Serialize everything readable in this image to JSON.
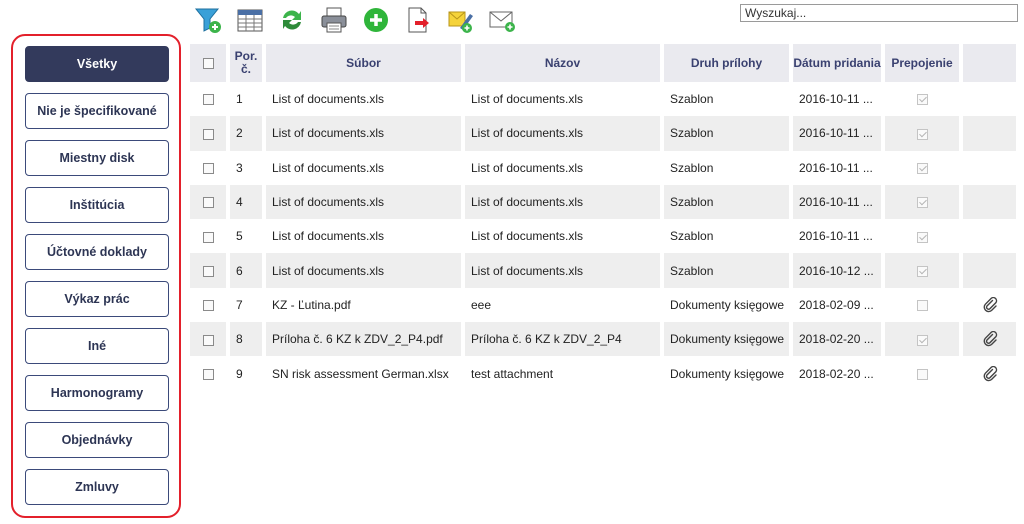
{
  "search": {
    "placeholder": "Wyszukaj..."
  },
  "toolbar": {
    "icons": [
      "filter-add-icon",
      "table-columns-icon",
      "refresh-icon",
      "print-icon",
      "add-icon",
      "export-document-icon",
      "edit-attachment-icon",
      "mail-add-icon"
    ]
  },
  "sidebar": {
    "items": [
      {
        "label": "Všetky",
        "active": true
      },
      {
        "label": "Nie je špecifikované"
      },
      {
        "label": "Miestny disk"
      },
      {
        "label": "Inštitúcia"
      },
      {
        "label": "Účtovné doklady"
      },
      {
        "label": "Výkaz prác"
      },
      {
        "label": "Iné"
      },
      {
        "label": "Harmonogramy"
      },
      {
        "label": "Objednávky"
      },
      {
        "label": "Zmluvy"
      }
    ]
  },
  "table": {
    "headers": {
      "num": "Por. č.",
      "file": "Súbor",
      "name": "Názov",
      "type": "Druh prílohy",
      "date": "Dátum pridania",
      "link": "Prepojenie"
    },
    "rows": [
      {
        "num": "1",
        "file": "List of documents.xls",
        "name": "List of documents.xls",
        "type": "Szablon",
        "date": "2016-10-11 ...",
        "linked": true,
        "attachment": false
      },
      {
        "num": "2",
        "file": "List of documents.xls",
        "name": "List of documents.xls",
        "type": "Szablon",
        "date": "2016-10-11 ...",
        "linked": true,
        "attachment": false
      },
      {
        "num": "3",
        "file": "List of documents.xls",
        "name": "List of documents.xls",
        "type": "Szablon",
        "date": "2016-10-11 ...",
        "linked": true,
        "attachment": false
      },
      {
        "num": "4",
        "file": "List of documents.xls",
        "name": "List of documents.xls",
        "type": "Szablon",
        "date": "2016-10-11 ...",
        "linked": true,
        "attachment": false
      },
      {
        "num": "5",
        "file": "List of documents.xls",
        "name": "List of documents.xls",
        "type": "Szablon",
        "date": "2016-10-11 ...",
        "linked": true,
        "attachment": false
      },
      {
        "num": "6",
        "file": "List of documents.xls",
        "name": "List of documents.xls",
        "type": "Szablon",
        "date": "2016-10-12 ...",
        "linked": true,
        "attachment": false
      },
      {
        "num": "7",
        "file": "KZ - Ľutina.pdf",
        "name": "eee",
        "type": "Dokumenty księgowe",
        "date": "2018-02-09 ...",
        "linked": false,
        "attachment": true
      },
      {
        "num": "8",
        "file": "Príloha č. 6 KZ k ZDV_2_P4.pdf",
        "name": "Príloha č. 6 KZ k ZDV_2_P4",
        "type": "Dokumenty księgowe",
        "date": "2018-02-20 ...",
        "linked": true,
        "attachment": true
      },
      {
        "num": "9",
        "file": "SN risk assessment German.xlsx",
        "name": "test attachment",
        "type": "Dokumenty księgowe",
        "date": "2018-02-20 ...",
        "linked": false,
        "attachment": true
      }
    ]
  }
}
